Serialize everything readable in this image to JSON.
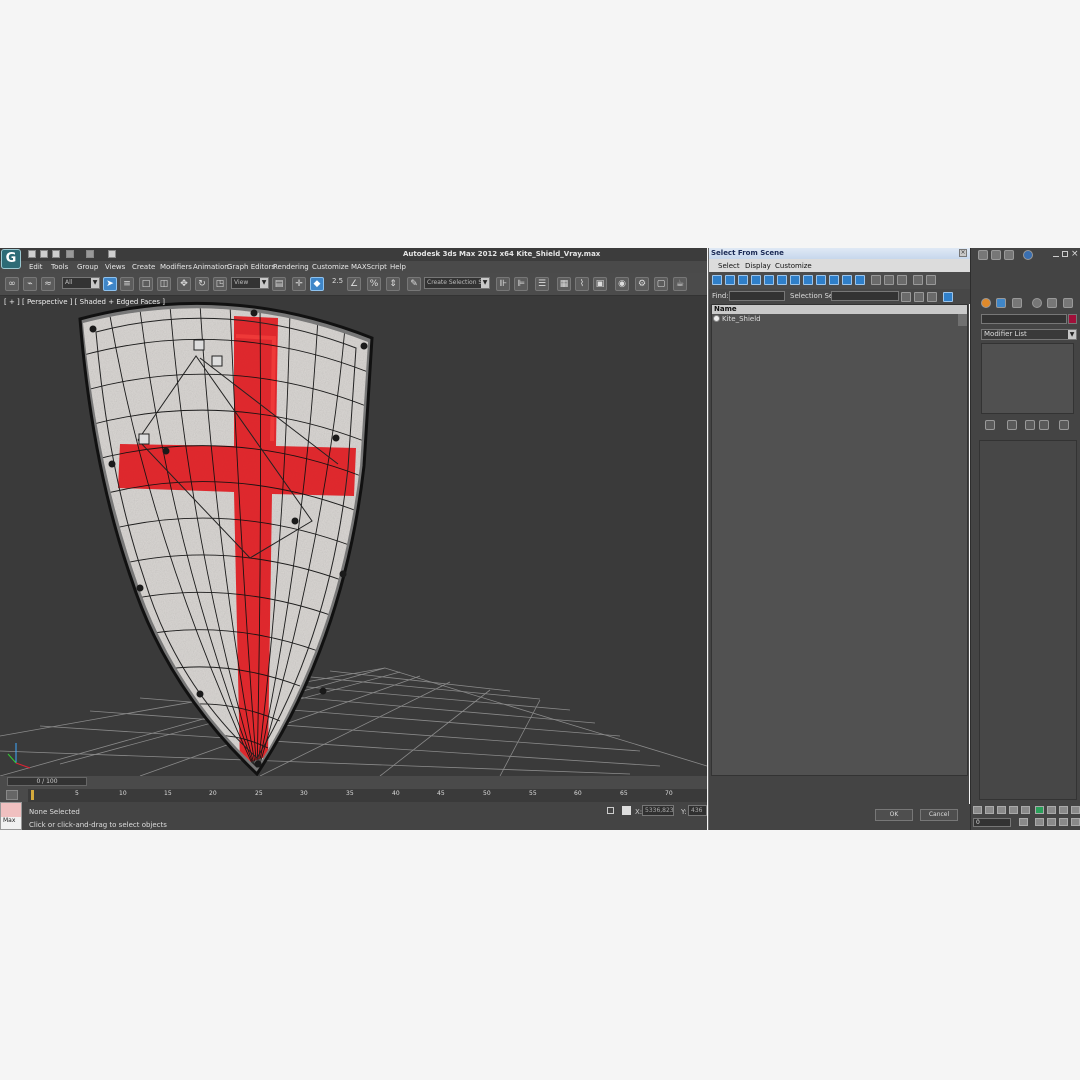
{
  "app": {
    "title": "Autodesk 3ds Max  2012 x64     Kite_Shield_Vray.max",
    "logo": "3ds-max-logo"
  },
  "menubar": {
    "items": [
      "Edit",
      "Tools",
      "Group",
      "Views",
      "Create",
      "Modifiers",
      "Animation",
      "Graph Editors",
      "Rendering",
      "Customize",
      "MAXScript",
      "Help"
    ]
  },
  "toolbar": {
    "selection_filter": "All",
    "reference_coord": "View",
    "named_selection_set": "Create Selection Se",
    "snap_value": "2.5"
  },
  "viewport": {
    "label": "[ + ] [ Perspective ] [ Shaded + Edged Faces ]",
    "object": "kite shield with red cross"
  },
  "timeline": {
    "frame_slider": "0 / 100",
    "ticks": [
      "5",
      "10",
      "15",
      "20",
      "25",
      "30",
      "35",
      "40",
      "45",
      "50",
      "55",
      "60",
      "65",
      "70"
    ]
  },
  "statusbar": {
    "max_label": "Max",
    "selection_status": "None Selected",
    "prompt": "Click or click-and-drag to select objects",
    "x_label": "X:",
    "x_value": "5336,823c",
    "y_label": "Y:",
    "y_value": "436"
  },
  "dialog": {
    "title": "Select From Scene",
    "menu": [
      "Select",
      "Display",
      "Customize"
    ],
    "find_label": "Find:",
    "selection_set_label": "Selection Set:",
    "column_header": "Name",
    "objects": [
      "Kite_Shield"
    ],
    "ok_label": "OK",
    "cancel_label": "Cancel"
  },
  "command_panel": {
    "modifier_list": "Modifier List",
    "object_color": "#a0103a",
    "frame_value": "0"
  },
  "colors": {
    "viewport_bg": "#3a3a3a",
    "cross_red": "#e01820",
    "dialog_title": "#c7d7ec",
    "accent_blue": "#3f86c8"
  }
}
